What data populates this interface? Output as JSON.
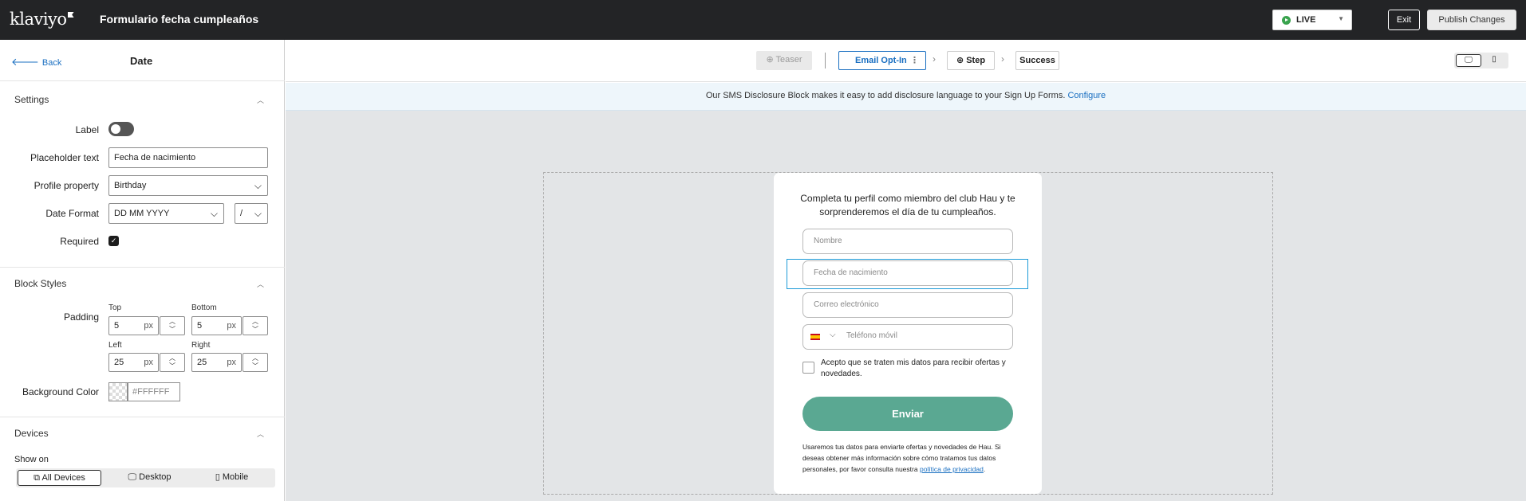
{
  "topbar": {
    "logo": "klaviyo",
    "form_title": "Formulario fecha cumpleaños",
    "status": "LIVE",
    "exit_label": "Exit",
    "publish_label": "Publish Changes"
  },
  "left_panel": {
    "back_label": "Back",
    "title": "Date",
    "settings": {
      "heading": "Settings",
      "label_label": "Label",
      "label_enabled": false,
      "placeholder_label": "Placeholder text",
      "placeholder_value": "Fecha de nacimiento",
      "profile_label": "Profile property",
      "profile_value": "Birthday",
      "date_format_label": "Date Format",
      "date_format_value": "DD MM YYYY",
      "separator_value": "/",
      "required_label": "Required",
      "required_checked": true
    },
    "block_styles": {
      "heading": "Block Styles",
      "padding_label": "Padding",
      "top_label": "Top",
      "top_value": "5",
      "bottom_label": "Bottom",
      "bottom_value": "5",
      "left_label": "Left",
      "left_value": "25",
      "right_label": "Right",
      "right_value": "25",
      "unit": "px",
      "bg_label": "Background Color",
      "bg_value": "#FFFFFF"
    },
    "devices": {
      "heading": "Devices",
      "show_on_label": "Show on",
      "options": [
        "All Devices",
        "Desktop",
        "Mobile"
      ],
      "selected": "All Devices"
    }
  },
  "canvas_header": {
    "steps": [
      {
        "label": "Teaser",
        "state": "disabled"
      },
      {
        "label": "Email Opt-In",
        "state": "active"
      },
      {
        "label": "Step",
        "state": "add"
      },
      {
        "label": "Success",
        "state": "normal"
      }
    ],
    "view": "desktop"
  },
  "banner": {
    "text": "Our SMS Disclosure Block makes it easy to add disclosure language to your Sign Up Forms.",
    "link": "Configure"
  },
  "form": {
    "heading": "Completa tu perfil como miembro del club Hau y te sorprenderemos el día de tu cumpleaños.",
    "name_placeholder": "Nombre",
    "date_placeholder": "Fecha de nacimiento",
    "email_placeholder": "Correo electrónico",
    "phone_placeholder": "Teléfono móvil",
    "consent_text": "Acepto que se traten mis datos para recibir ofertas y novedades.",
    "submit_label": "Enviar",
    "privacy_text": "Usaremos tus datos para enviarte ofertas y novedades de Hau. Si deseas obtener más información sobre cómo tratamos tus datos personales, por favor consulta nuestra",
    "privacy_link": "política de privacidad",
    "privacy_end": ".",
    "button_color": "#5AA892"
  },
  "colors": {
    "topbar": "#232426",
    "accent": "#1A6FC1",
    "selection": "#1D9BD8",
    "live": "#3AA34E"
  }
}
